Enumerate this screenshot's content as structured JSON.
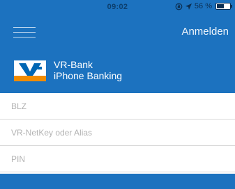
{
  "status_bar": {
    "time": "09:02",
    "battery_text": "56 %",
    "battery_level": 0.56,
    "icons": [
      "lock-rotation-icon",
      "location-arrow-icon",
      "battery-icon"
    ]
  },
  "header": {
    "menu_icon": "hamburger-menu-icon",
    "login_label": "Anmelden",
    "title_line1": "VR-Bank",
    "title_line2": "iPhone Banking",
    "logo": "volksbank-raiffeisenbank-logo"
  },
  "form": {
    "blz_placeholder": "BLZ",
    "netkey_placeholder": "VR-NetKey oder Alias",
    "pin_placeholder": "PIN"
  },
  "colors": {
    "brand_blue": "#1c72bf",
    "logo_orange": "#f28c00",
    "logo_blue": "#0066b3",
    "divider": "#d9d9d9",
    "placeholder": "#b3b3b3"
  }
}
